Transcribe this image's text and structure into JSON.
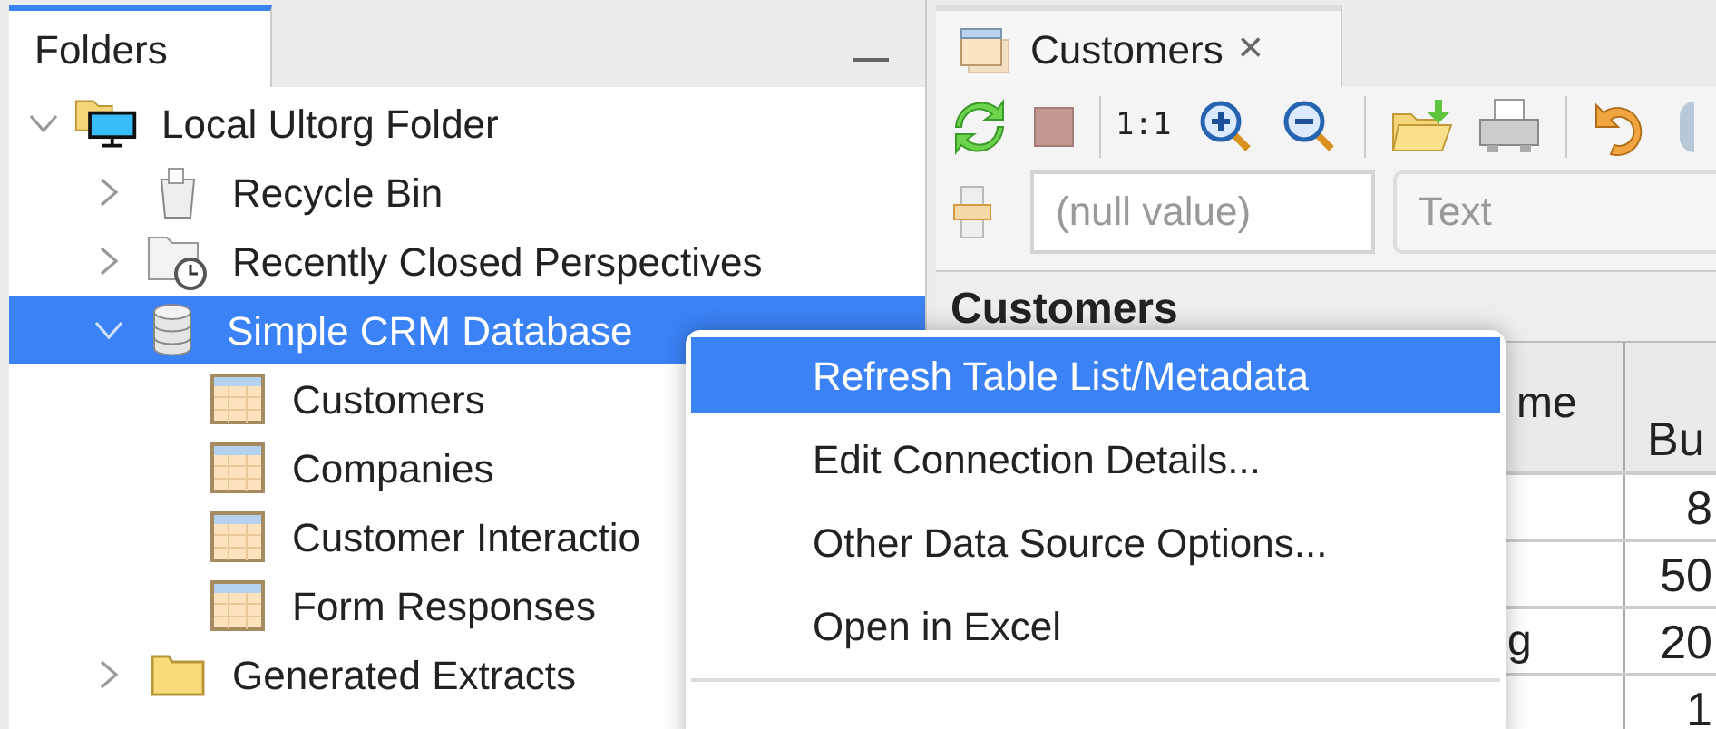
{
  "folders_panel": {
    "title": "Folders",
    "tree": [
      {
        "label": "Local Ultorg Folder",
        "kind": "local-folder",
        "expanded": true,
        "selected": false,
        "children": [
          {
            "label": "Recycle Bin",
            "kind": "recycle-bin",
            "expanded": false,
            "selected": false
          },
          {
            "label": "Recently Closed Perspectives",
            "kind": "history-folder",
            "expanded": false,
            "selected": false
          },
          {
            "label": "Simple CRM Database",
            "kind": "database",
            "expanded": true,
            "selected": true,
            "children": [
              {
                "label": "Customers",
                "kind": "table",
                "selected": false
              },
              {
                "label": "Companies",
                "kind": "table",
                "selected": false
              },
              {
                "label": "Customer Interactio",
                "kind": "table",
                "selected": false
              },
              {
                "label": "Form Responses",
                "kind": "table",
                "selected": false
              }
            ]
          },
          {
            "label": "Generated Extracts",
            "kind": "folder",
            "expanded": false,
            "selected": false
          }
        ]
      }
    ]
  },
  "editor": {
    "tab": {
      "title": "Customers",
      "close": "×"
    },
    "toolbar": {
      "zoom_reset": "1:1"
    },
    "filter": {
      "value_placeholder": "(null value)",
      "type_placeholder": "Text"
    },
    "table": {
      "title": "Customers",
      "columns": [
        "me",
        "Bu"
      ],
      "rows": [
        [
          "",
          "8"
        ],
        [
          "",
          "50"
        ],
        [
          "g",
          "20"
        ],
        [
          "",
          "1"
        ]
      ]
    }
  },
  "context_menu": {
    "items": [
      {
        "label": "Refresh Table List/Metadata",
        "selected": true
      },
      {
        "label": "Edit Connection Details...",
        "selected": false
      },
      {
        "label": "Other Data Source Options...",
        "selected": false
      },
      {
        "label": "Open in Excel",
        "selected": false
      }
    ]
  }
}
